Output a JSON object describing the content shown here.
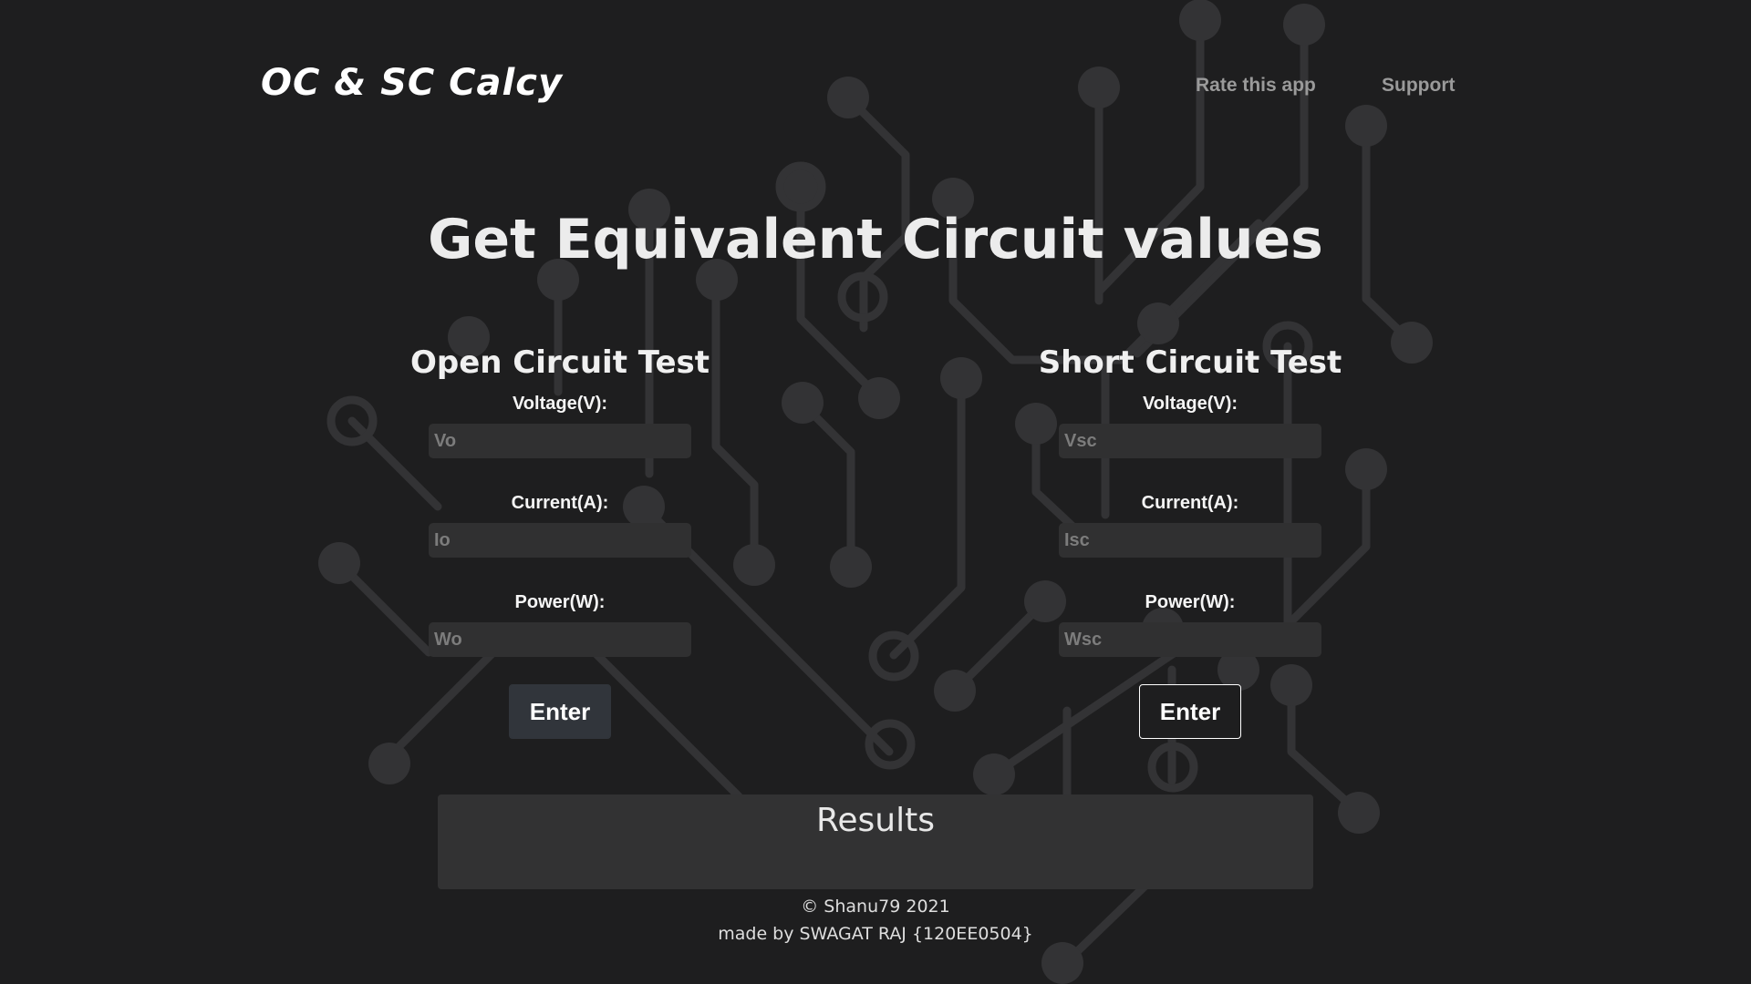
{
  "header": {
    "logo": "OC & SC Calcy",
    "nav": {
      "rate": "Rate this app",
      "support": "Support"
    }
  },
  "hero": {
    "title": "Get Equivalent Circuit values"
  },
  "open_circuit": {
    "title": "Open Circuit Test",
    "voltage_label": "Voltage(V):",
    "voltage_placeholder": "Vo",
    "current_label": "Current(A):",
    "current_placeholder": "Io",
    "power_label": "Power(W):",
    "power_placeholder": "Wo",
    "enter_label": "Enter"
  },
  "short_circuit": {
    "title": "Short Circuit Test",
    "voltage_label": "Voltage(V):",
    "voltage_placeholder": "Vsc",
    "current_label": "Current(A):",
    "current_placeholder": "Isc",
    "power_label": "Power(W):",
    "power_placeholder": "Wsc",
    "enter_label": "Enter"
  },
  "results": {
    "title": "Results"
  },
  "footer": {
    "copyright": "© Shanu79 2021",
    "credit": "made by SWAGAT RAJ {120EE0504}"
  },
  "colors": {
    "background": "#1e1e1f",
    "circuit": "#343436",
    "input_bg": "#303031",
    "button_dark": "#31353b"
  }
}
